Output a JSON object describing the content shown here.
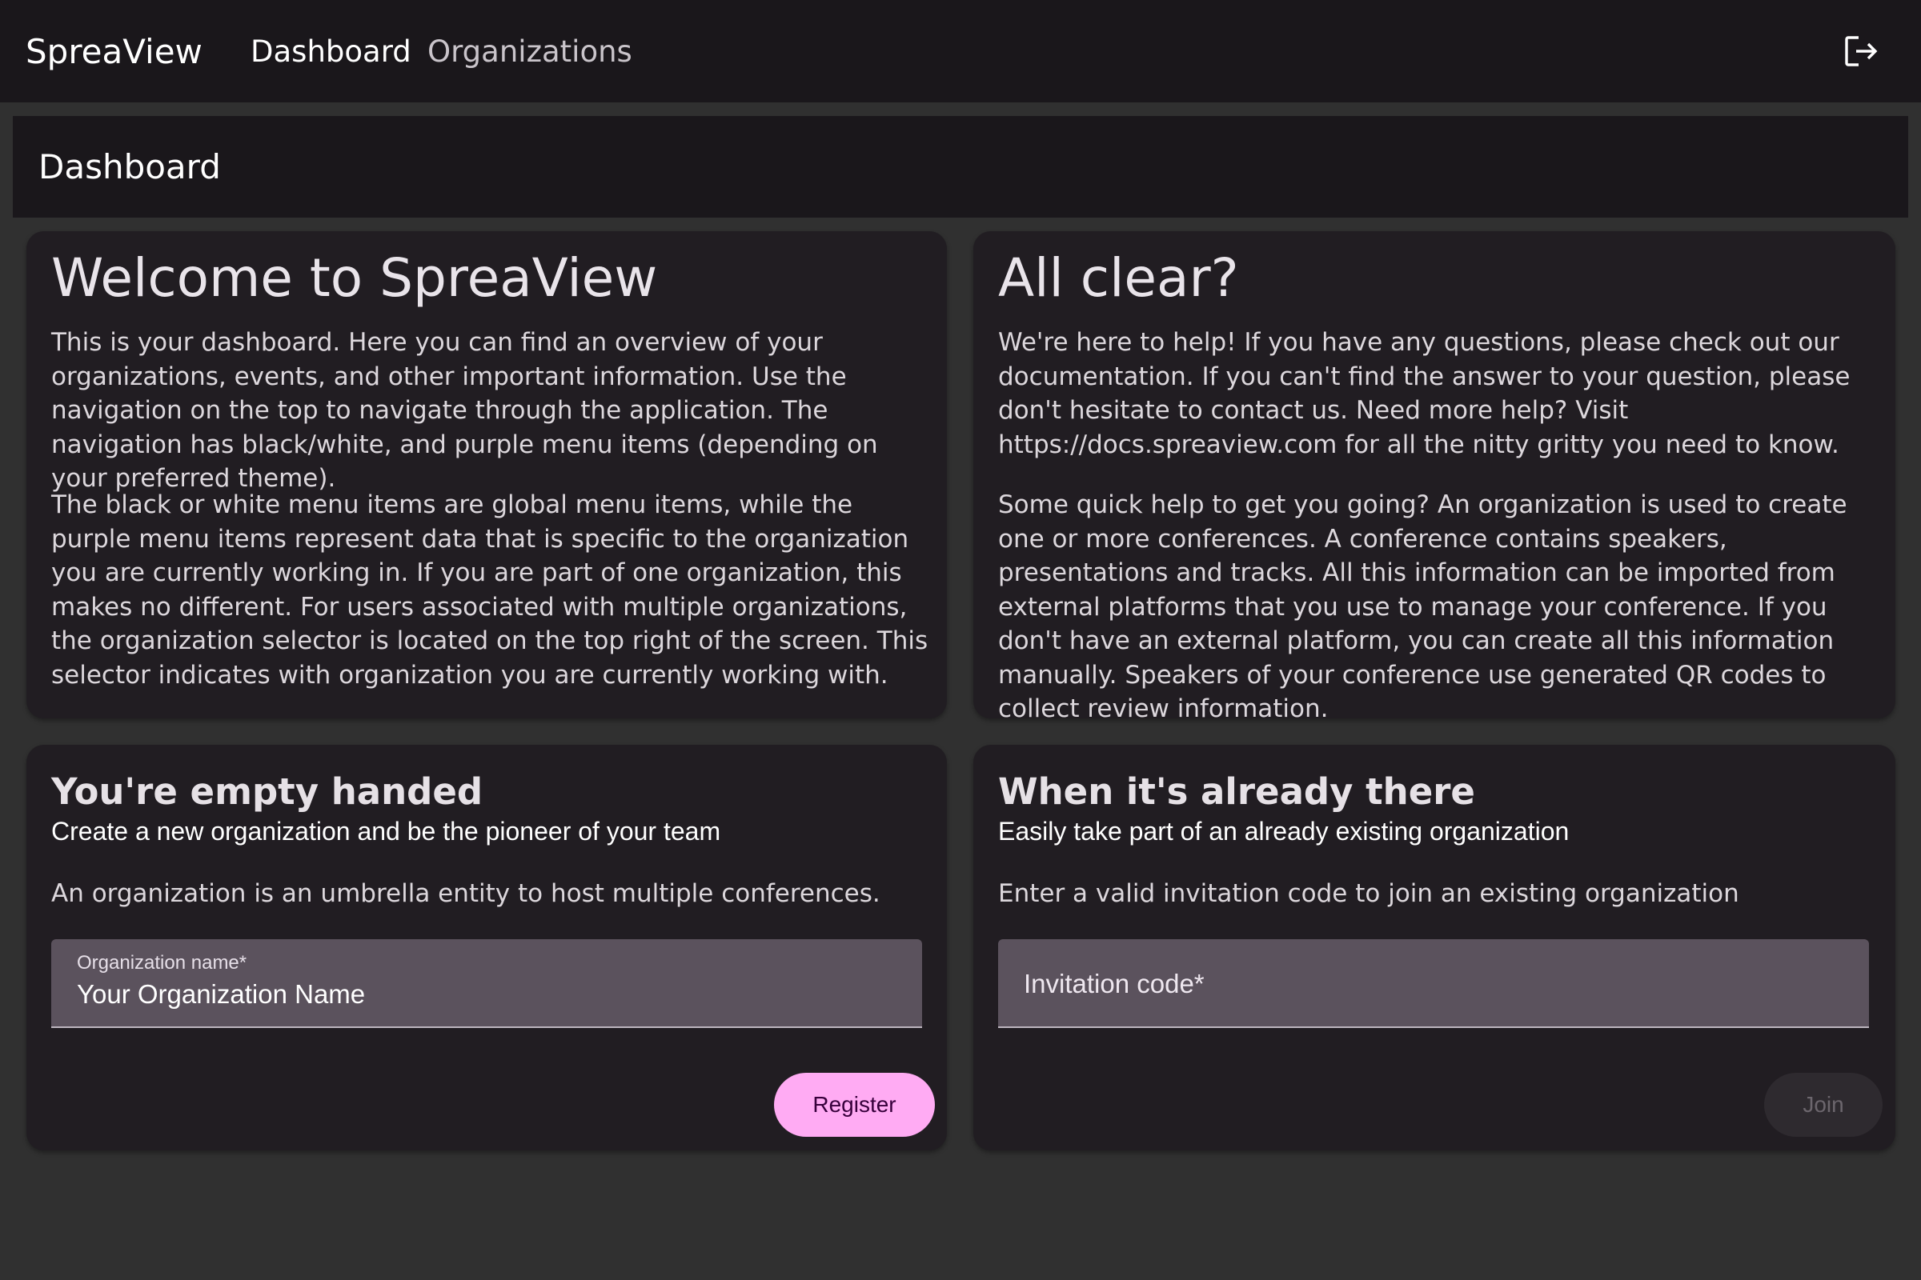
{
  "app": {
    "brand": "SpreaView"
  },
  "nav": {
    "items": [
      {
        "label": "Dashboard",
        "active": true
      },
      {
        "label": "Organizations",
        "active": false
      }
    ],
    "logout_icon": "logout-icon"
  },
  "page": {
    "title": "Dashboard"
  },
  "welcome": {
    "title": "Welcome to SpreaView",
    "paragraphs": [
      "This is your dashboard. Here you can find an overview of your organizations, events, and other important information. Use the navigation on the top to navigate through the application. The navigation has black/white, and purple menu items (depending on your preferred theme).",
      "The black or white menu items are global menu items, while the purple menu items represent data that is specific to the organization you are currently working in. If you are part of one organization, this makes no different. For users associated with multiple organizations, the organization selector is located on the top right of the screen. This selector indicates with organization you are currently working with."
    ]
  },
  "all_clear": {
    "title": "All clear?",
    "paragraphs": [
      "We're here to help! If you have any questions, please check out our documentation. If you can't find the answer to your question, please don't hesitate to contact us. Need more help? Visit https://docs.spreaview.com for all the nitty gritty you need to know.",
      "Some quick help to get you going? An organization is used to create one or more conferences. A conference contains speakers, presentations and tracks. All this information can be imported from external platforms that you use to manage your conference. If you don't have an external platform, you can create all this information manually. Speakers of your conference use generated QR codes to collect review information."
    ]
  },
  "create_org": {
    "title": "You're empty handed",
    "subtitle": "Create a new organization and be the pioneer of your team",
    "description": "An organization is an umbrella entity to host multiple conferences.",
    "field_label": "Organization name*",
    "field_value": "Your Organization Name",
    "button_label": "Register"
  },
  "join_org": {
    "title": "When it's already there",
    "subtitle": "Easily take part of an already existing organization",
    "description": "Enter a valid invitation code to join an existing organization",
    "field_label": "Invitation code*",
    "field_value": "",
    "button_label": "Join",
    "button_disabled": true
  },
  "colors": {
    "background": "#303030",
    "bar": "#1a171b",
    "card": "#211d22",
    "field": "#5b525d",
    "accent": "#ffabf3"
  }
}
